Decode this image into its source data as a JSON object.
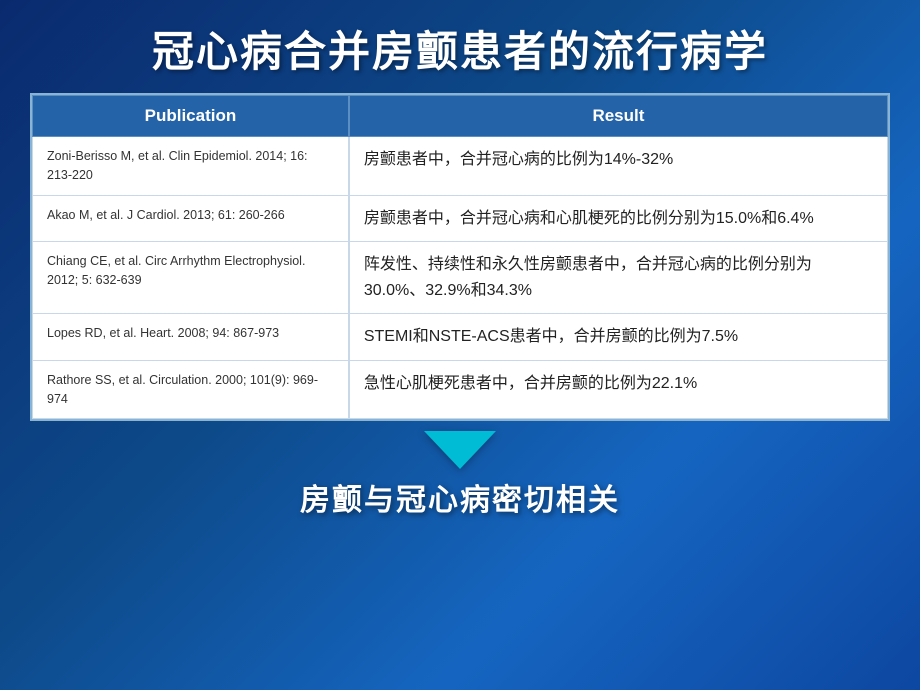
{
  "title": "冠心病合并房颤患者的流行病学",
  "table": {
    "headers": [
      "Publication",
      "Result"
    ],
    "rows": [
      {
        "publication": "Zoni-Berisso M, et al. Clin Epidemiol. 2014; 16: 213-220",
        "result": "房颤患者中，合并冠心病的比例为14%-32%"
      },
      {
        "publication": "Akao M, et al. J Cardiol. 2013; 61: 260-266",
        "result": "房颤患者中，合并冠心病和心肌梗死的比例分别为15.0%和6.4%"
      },
      {
        "publication": "Chiang CE, et al. Circ Arrhythm Electrophysiol. 2012; 5: 632-639",
        "result": "阵发性、持续性和永久性房颤患者中，合并冠心病的比例分别为30.0%、32.9%和34.3%"
      },
      {
        "publication": "Lopes RD, et al. Heart. 2008; 94: 867-973",
        "result": "STEMI和NSTE-ACS患者中，合并房颤的比例为7.5%"
      },
      {
        "publication": "Rathore SS, et al. Circulation. 2000; 101(9): 969-974",
        "result": "急性心肌梗死患者中，合并房颤的比例为22.1%"
      }
    ]
  },
  "conclusion": "房颤与冠心病密切相关",
  "arrow_color": "#00bcd4"
}
